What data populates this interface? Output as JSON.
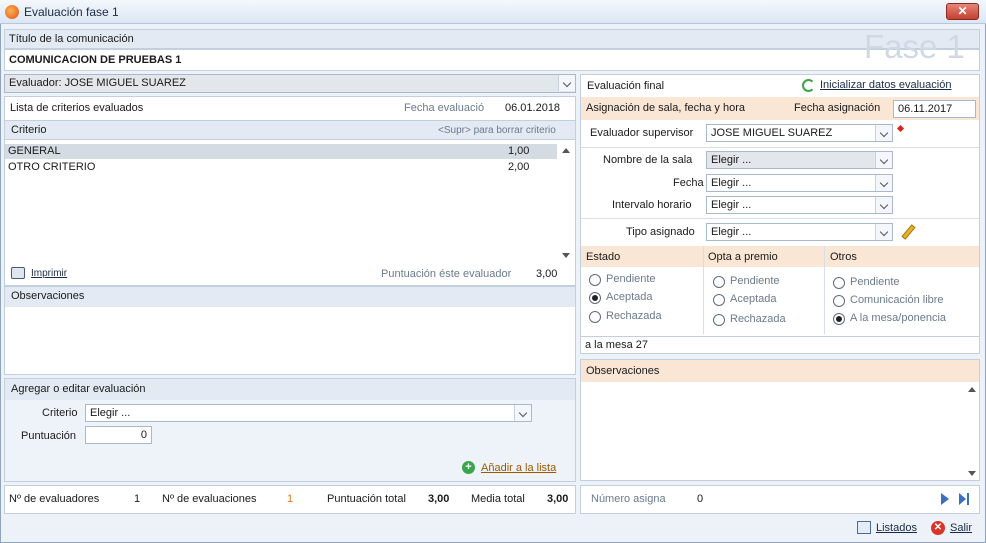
{
  "window": {
    "title": "Evaluación fase 1"
  },
  "header": {
    "section_label": "Título de la comunicación",
    "communication_title": "COMUNICACION DE PRUEBAS 1",
    "watermark": "Fase 1"
  },
  "evaluator": {
    "label": "Evaluador: JOSE MIGUEL SUAREZ"
  },
  "criteria": {
    "list_title": "Lista de criterios evaluados",
    "date_label": "Fecha evaluació",
    "date_value": "06.01.2018",
    "col_criterio": "Criterio",
    "delete_hint": "<Supr> para borrar criterio",
    "rows": [
      {
        "name": "GENERAL",
        "value": "1,00"
      },
      {
        "name": "OTRO CRITERIO",
        "value": "2,00"
      }
    ],
    "print_label": "Imprimir",
    "score_label": "Puntuación éste evaluador",
    "score_value": "3,00"
  },
  "observaciones_left": {
    "label": "Observaciones"
  },
  "add_edit": {
    "title": "Agregar o editar evaluación",
    "criterio_label": "Criterio",
    "criterio_value": "Elegir ...",
    "puntuacion_label": "Puntuación",
    "puntuacion_value": "0",
    "add_label": "Añadir a la lista"
  },
  "footer_left": {
    "n_evaluadores_label": "Nº de evaluadores",
    "n_evaluadores": "1",
    "n_evaluaciones_label": "Nº de evaluaciones",
    "n_evaluaciones": "1",
    "puntuacion_total_label": "Puntuación total",
    "puntuacion_total": "3,00",
    "media_total_label": "Media total",
    "media_total": "3,00"
  },
  "final": {
    "title": "Evaluación final",
    "reset_label": "Inicializar datos evaluación",
    "assign_title": "Asignación de sala, fecha y hora",
    "assign_date_label": "Fecha asignación",
    "assign_date_value": "06.11.2017",
    "supervisor_label": "Evaluador supervisor",
    "supervisor_value": "JOSE MIGUEL SUAREZ",
    "sala_label": "Nombre de la sala",
    "sala_value": "Elegir ...",
    "fecha_label": "Fecha",
    "fecha_value": "Elegir ...",
    "intervalo_label": "Intervalo horario",
    "intervalo_value": "Elegir ...",
    "tipo_label": "Tipo asignado",
    "tipo_value": "Elegir ...",
    "estado": {
      "title": "Estado",
      "options": [
        "Pendiente",
        "Aceptada",
        "Rechazada"
      ],
      "selected": 1
    },
    "opta": {
      "title": "Opta a premio",
      "options": [
        "Pendiente",
        "Aceptada",
        "Rechazada"
      ],
      "selected": -1
    },
    "otros": {
      "title": "Otros",
      "options": [
        "Pendiente",
        "Comunicación libre",
        "A la mesa/ponencia"
      ],
      "selected": 2
    },
    "note": "a la mesa 27",
    "observaciones_label": "Observaciones",
    "numero_label": "Número asigna",
    "numero_value": "0"
  },
  "bottom": {
    "listados_label": "Listados",
    "salir_label": "Salir"
  },
  "colors": {
    "accent_orange": "#e07a1c",
    "header_blue": "#e3eaf3",
    "peach": "#fae6d4",
    "link_green": "#2e9a3c"
  }
}
